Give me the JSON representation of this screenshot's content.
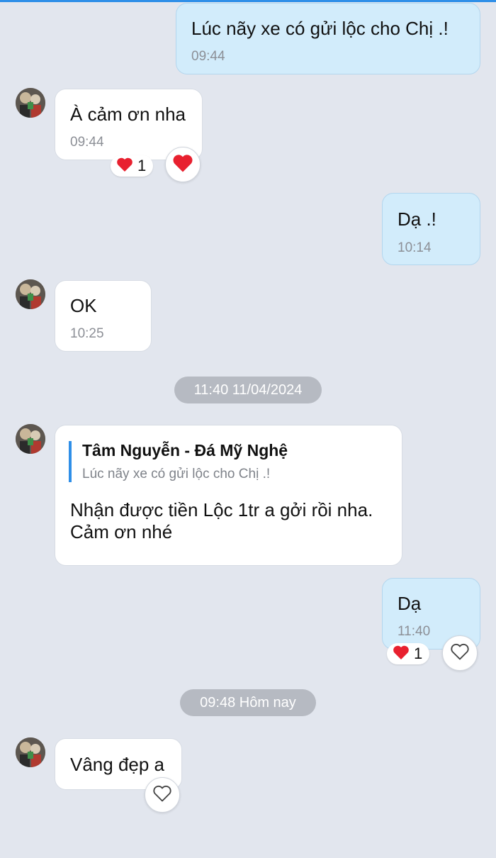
{
  "messages": [
    {
      "text": "Lúc nãy xe có gửi lộc cho Chị .!",
      "time": "09:44"
    },
    {
      "text": "À cảm ơn nha",
      "time": "09:44",
      "reaction_count": "1"
    },
    {
      "text": "Dạ .!",
      "time": "10:14"
    },
    {
      "text": "OK",
      "time": "10:25"
    },
    {
      "quote_author": "Tâm Nguyễn - Đá Mỹ Nghệ",
      "quote_text": "Lúc nãy xe có gửi lộc cho Chị .!",
      "text_line1": "Nhận được tiền Lộc 1tr a gởi rồi nha.",
      "text_line2": "Cảm ơn nhé"
    },
    {
      "text": "Dạ",
      "time": "11:40",
      "reaction_count": "1"
    },
    {
      "text": "Vâng đẹp a"
    }
  ],
  "separators": [
    "11:40 11/04/2024",
    "09:48 Hôm nay"
  ],
  "colors": {
    "background": "#e2e6ee",
    "outgoing_bubble": "#d2ecfb",
    "incoming_bubble": "#ffffff",
    "accent": "#2f8fe8",
    "heart": "#e8202f"
  }
}
